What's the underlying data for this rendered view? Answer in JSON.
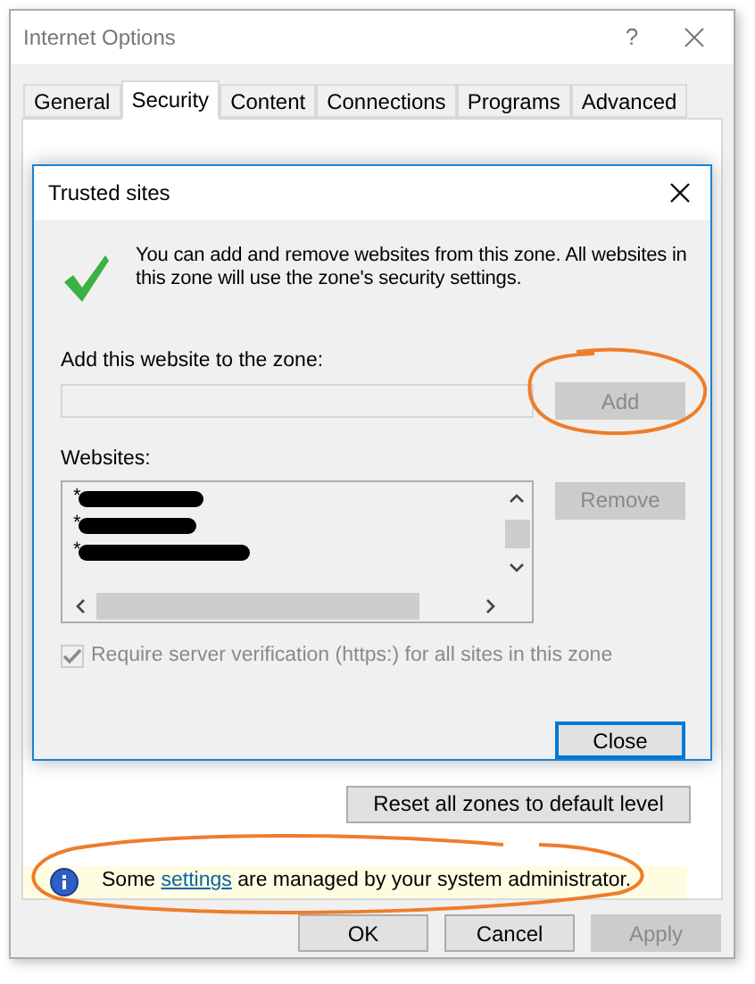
{
  "window": {
    "title": "Internet Options",
    "help": "?"
  },
  "tabs": [
    {
      "label": "General",
      "selected": false
    },
    {
      "label": "Security",
      "selected": true
    },
    {
      "label": "Content",
      "selected": false
    },
    {
      "label": "Connections",
      "selected": false
    },
    {
      "label": "Programs",
      "selected": false
    },
    {
      "label": "Advanced",
      "selected": false
    }
  ],
  "dialog": {
    "title": "Trusted sites",
    "message": "You can add and remove websites from this zone. All websites in this zone will use the zone's security settings.",
    "add_label": "Add this website to the zone:",
    "add_button": {
      "label": "Add",
      "disabled": true
    },
    "websites_label": "Websites:",
    "websites": [
      {
        "text": "*",
        "redacted": true
      },
      {
        "text": "*",
        "redacted": true
      },
      {
        "text": "*",
        "redacted": true
      }
    ],
    "remove_button": {
      "label": "Remove",
      "disabled": true
    },
    "require_https": {
      "label": "Require server verification (https:) for all sites in this zone",
      "checked": true,
      "disabled": true
    },
    "close_button": {
      "label": "Close"
    }
  },
  "reset_button": "Reset all zones to default level",
  "info_bar": {
    "before": "Some",
    "link": "settings",
    "after": "are managed by your system administrator."
  },
  "buttons": [
    {
      "label": "OK",
      "disabled": false
    },
    {
      "label": "Cancel",
      "disabled": false
    },
    {
      "label": "Apply",
      "disabled": true
    }
  ]
}
